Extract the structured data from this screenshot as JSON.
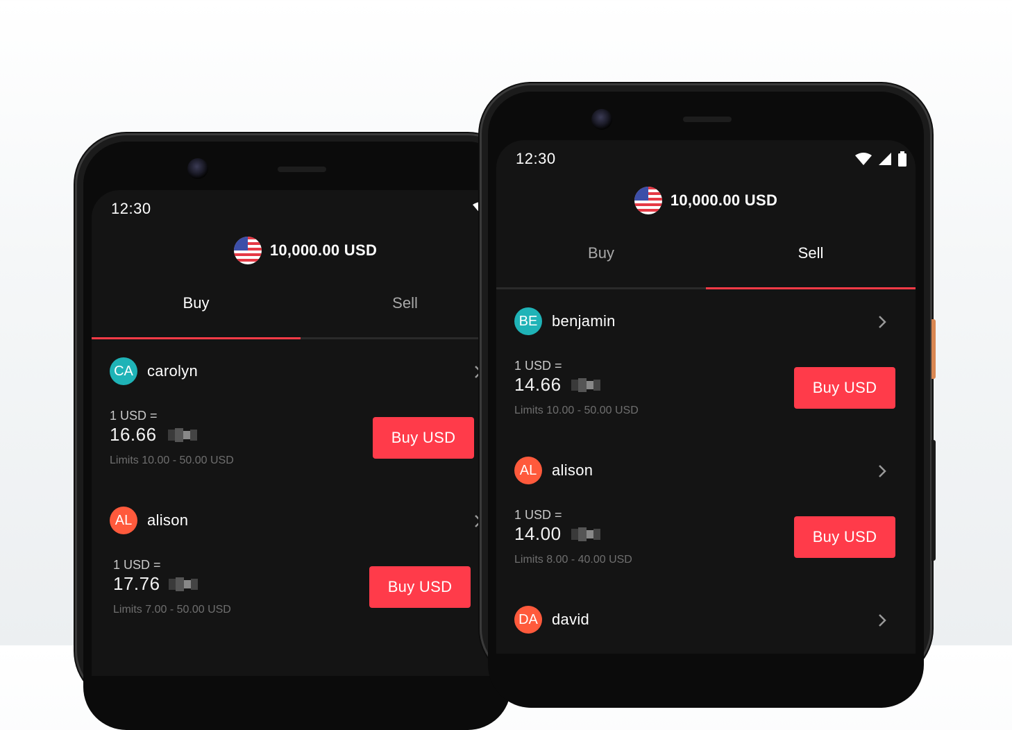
{
  "status": {
    "time": "12:30"
  },
  "balance": {
    "amount": "10,000.00 USD"
  },
  "left_phone": {
    "tabs": [
      {
        "label": "Buy",
        "active": true
      },
      {
        "label": "Sell",
        "active": false
      }
    ],
    "offers": [
      {
        "initials": "CA",
        "name": "carolyn",
        "avatar_color": "#1fb3b7",
        "rate_label": "1 USD =",
        "rate": "16.66",
        "limits": "Limits 10.00 - 50.00 USD",
        "button": "Buy USD"
      },
      {
        "initials": "AL",
        "name": "alison",
        "avatar_color": "#ff5a3c",
        "rate_label": "1 USD =",
        "rate": "17.76",
        "limits": "Limits 7.00 - 50.00 USD",
        "button": "Buy USD"
      }
    ]
  },
  "right_phone": {
    "tabs": [
      {
        "label": "Buy",
        "active": false
      },
      {
        "label": "Sell",
        "active": true
      }
    ],
    "offers": [
      {
        "initials": "BE",
        "name": "benjamin",
        "avatar_color": "#1fb3b7",
        "rate_label": "1 USD =",
        "rate": "14.66",
        "limits": "Limits 10.00 - 50.00 USD",
        "button": "Buy USD"
      },
      {
        "initials": "AL",
        "name": "alison",
        "avatar_color": "#ff5a3c",
        "rate_label": "1 USD =",
        "rate": "14.00",
        "limits": "Limits 8.00 - 40.00 USD",
        "button": "Buy USD"
      },
      {
        "initials": "DA",
        "name": "david",
        "avatar_color": "#ff5a3c"
      }
    ]
  },
  "colors": {
    "accent": "#ff3b4a",
    "background": "#141414",
    "teal": "#1fb3b7",
    "orange": "#ff5a3c"
  },
  "icons": [
    "wifi-icon",
    "signal-icon",
    "battery-icon",
    "us-flag-icon",
    "chevron-right-icon",
    "front-camera-icon"
  ]
}
